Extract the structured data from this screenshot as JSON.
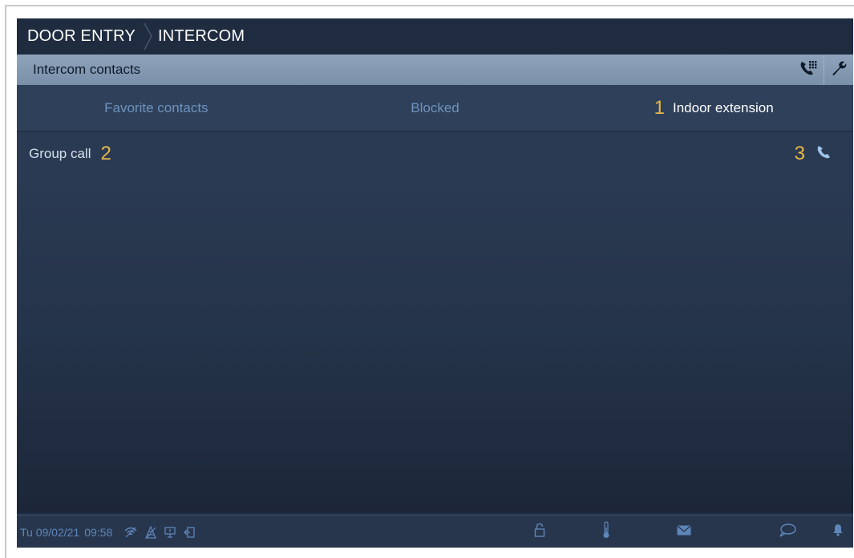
{
  "breadcrumb": {
    "items": [
      "DOOR ENTRY",
      "INTERCOM"
    ]
  },
  "section": {
    "title": "Intercom contacts"
  },
  "tabs": [
    {
      "label": "Favorite contacts",
      "active": false,
      "marker": ""
    },
    {
      "label": "Blocked",
      "active": false,
      "marker": ""
    },
    {
      "label": "Indoor extension",
      "active": true,
      "marker": "1"
    }
  ],
  "group_call": {
    "label": "Group call",
    "marker_left": "2",
    "marker_right": "3"
  },
  "status": {
    "date": "Tu 09/02/21",
    "time": "09:58"
  },
  "icons": {
    "header": [
      "dialpad-phone-icon",
      "wrench-icon"
    ],
    "row": "phone-icon",
    "status_left": [
      "wifi-icon",
      "signal-icon",
      "monitor-icon",
      "exit-icon"
    ],
    "status_right": [
      "lock-icon",
      "thermometer-icon",
      "mail-icon",
      "chat-icon",
      "bell-icon"
    ]
  },
  "colors": {
    "accent_marker": "#e6b84a",
    "tab_inactive": "#6f93bd",
    "background": "#23324a"
  }
}
